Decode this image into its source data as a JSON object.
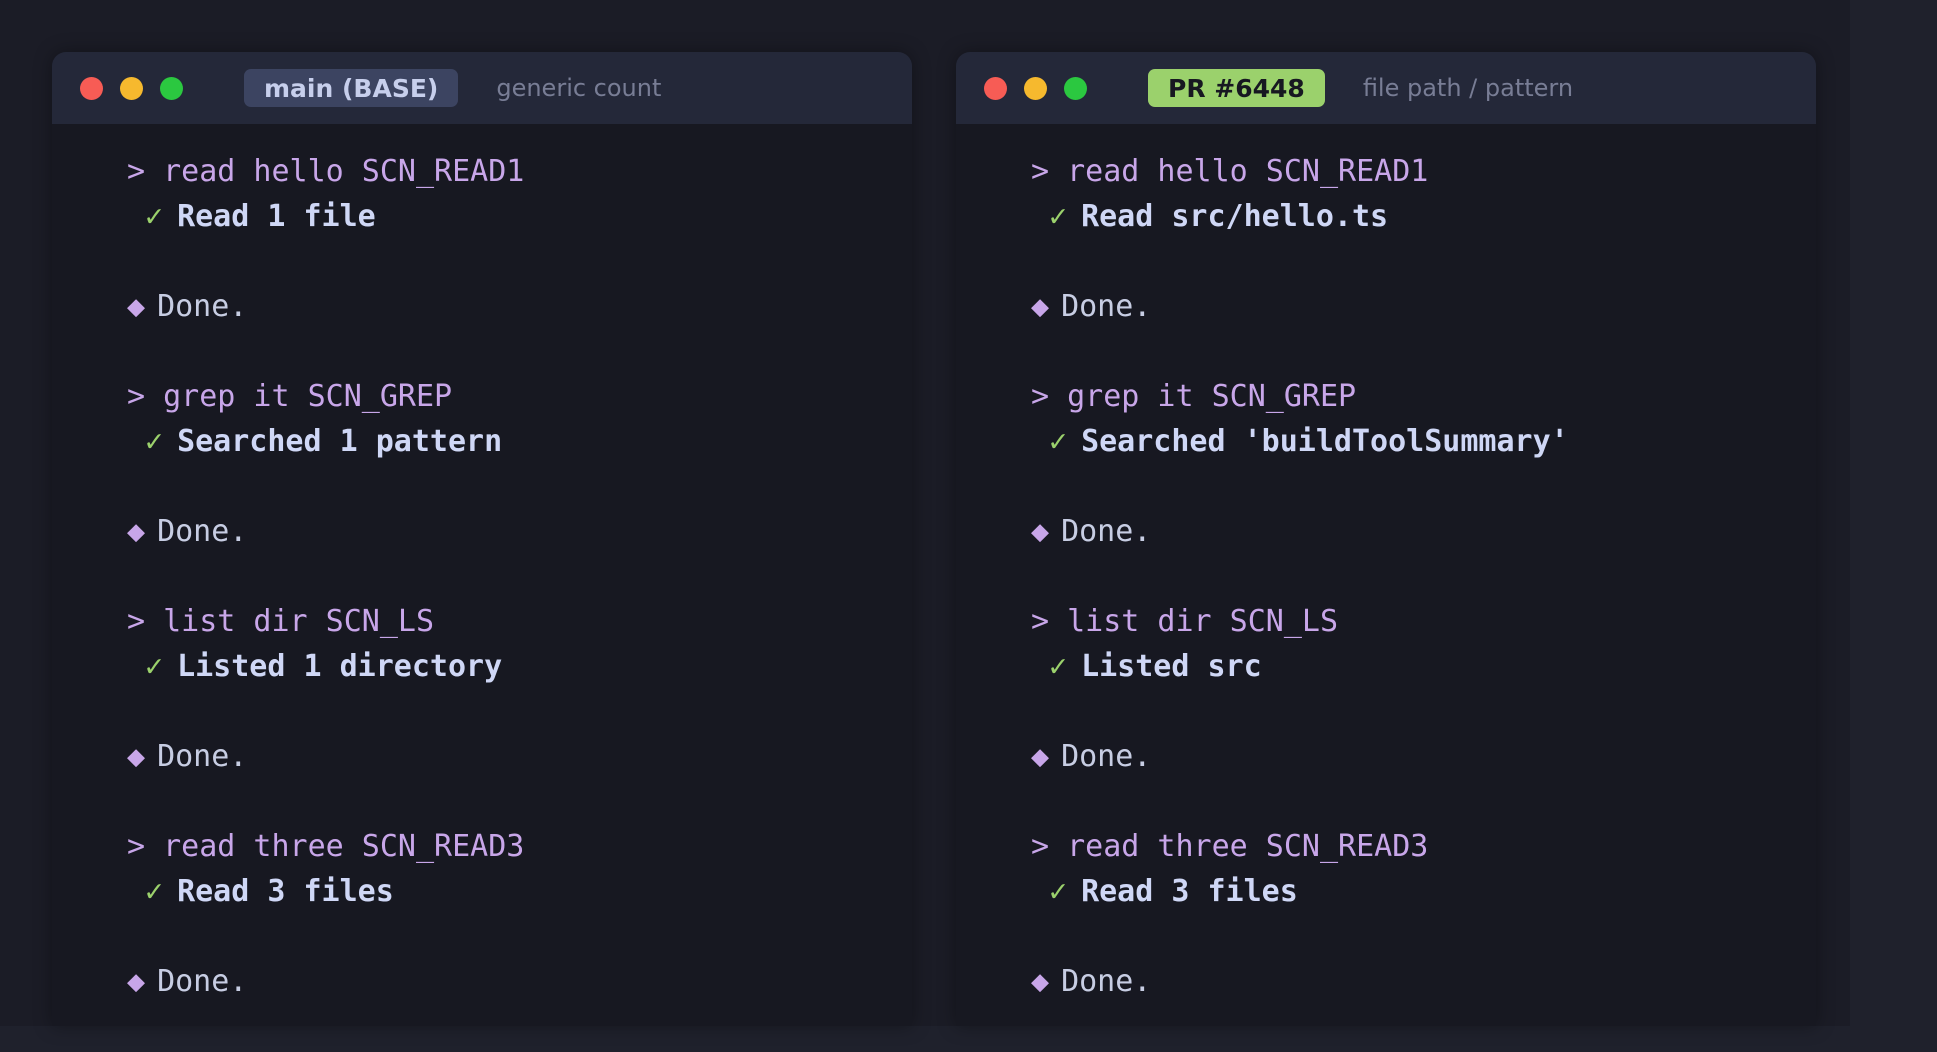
{
  "panes": [
    {
      "branch_label": "main (BASE)",
      "subtitle": "generic count",
      "entries": [
        {
          "prompt": "> read hello SCN_READ1",
          "result": "Read 1 file",
          "done": "Done."
        },
        {
          "prompt": "> grep it SCN_GREP",
          "result": "Searched 1 pattern",
          "done": "Done."
        },
        {
          "prompt": "> list dir SCN_LS",
          "result": "Listed 1 directory",
          "done": "Done."
        },
        {
          "prompt": "> read three SCN_READ3",
          "result": "Read 3 files",
          "done": "Done."
        }
      ]
    },
    {
      "branch_label": "PR #6448",
      "subtitle": "file path / pattern",
      "entries": [
        {
          "prompt": "> read hello SCN_READ1",
          "result": "Read src/hello.ts",
          "done": "Done."
        },
        {
          "prompt": "> grep it SCN_GREP",
          "result": "Searched 'buildToolSummary'",
          "done": "Done."
        },
        {
          "prompt": "> list dir SCN_LS",
          "result": "Listed src",
          "done": "Done."
        },
        {
          "prompt": "> read three SCN_READ3",
          "result": "Read 3 files",
          "done": "Done."
        }
      ]
    }
  ],
  "glyphs": {
    "check": "✓",
    "diamond": "◆"
  },
  "colors": {
    "base_badge": "#3c4461",
    "pr_badge": "#9bd16c",
    "prompt": "#c8a6e9",
    "check": "#9bd16c"
  }
}
